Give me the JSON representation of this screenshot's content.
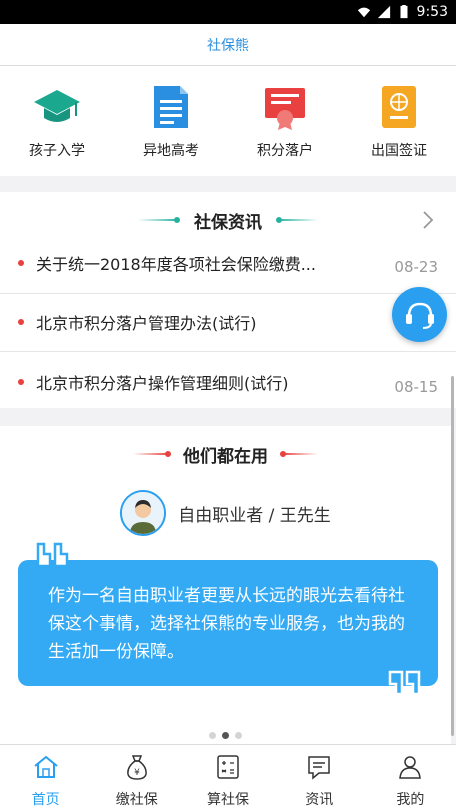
{
  "status_bar": {
    "time": "9:53"
  },
  "appbar": {
    "title": "社保熊"
  },
  "quick_actions": [
    {
      "label": "孩子入学",
      "icon": "graduation-cap-icon",
      "color": "#1aa88f"
    },
    {
      "label": "异地高考",
      "icon": "document-icon",
      "color": "#2a8fe0"
    },
    {
      "label": "积分落户",
      "icon": "certificate-icon",
      "color": "#e8413f"
    },
    {
      "label": "出国签证",
      "icon": "passport-icon",
      "color": "#f5a623"
    }
  ],
  "news": {
    "title": "社保资讯",
    "items": [
      {
        "title": "关于统一2018年度各项社会保险缴费...",
        "date": "08-23"
      },
      {
        "title": "北京市积分落户管理办法(试行)",
        "date": ""
      },
      {
        "title": "北京市积分落户操作管理细则(试行)",
        "date": "08-15"
      }
    ]
  },
  "testimonials": {
    "title": "他们都在用",
    "person": "自由职业者 / 王先生",
    "quote": "作为一名自由职业者更要从长远的眼光去看待社保这个事情，选择社保熊的专业服务，也为我的生活加一份保障。",
    "page_index": 2,
    "page_count": 3
  },
  "tabs": [
    {
      "label": "首页",
      "icon": "home-icon",
      "active": true
    },
    {
      "label": "缴社保",
      "icon": "money-bag-icon",
      "active": false
    },
    {
      "label": "算社保",
      "icon": "calculator-icon",
      "active": false
    },
    {
      "label": "资讯",
      "icon": "news-icon",
      "active": false
    },
    {
      "label": "我的",
      "icon": "profile-icon",
      "active": false
    }
  ],
  "colors": {
    "accent": "#2a9ff0",
    "teal": "#27b2a0",
    "red": "#e8413f",
    "bubble": "#33aaf3"
  }
}
